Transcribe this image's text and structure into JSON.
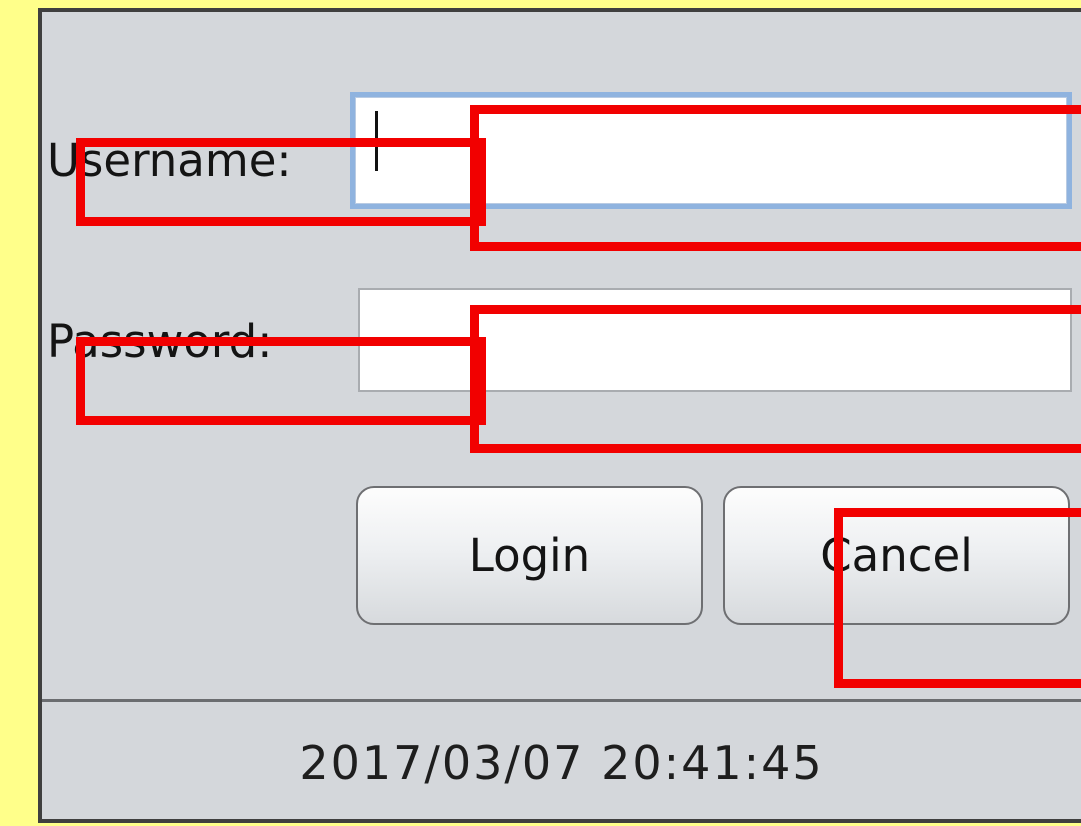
{
  "login_form": {
    "username_label": "Username:",
    "username_value": "",
    "password_label": "Password:",
    "password_value": "",
    "login_button": "Login",
    "cancel_button": "Cancel"
  },
  "status_bar": {
    "timestamp": "2017/03/07 20:41:45"
  },
  "annotation": {
    "highlight_color": "#f20000",
    "background_color": "#ffff8a"
  }
}
